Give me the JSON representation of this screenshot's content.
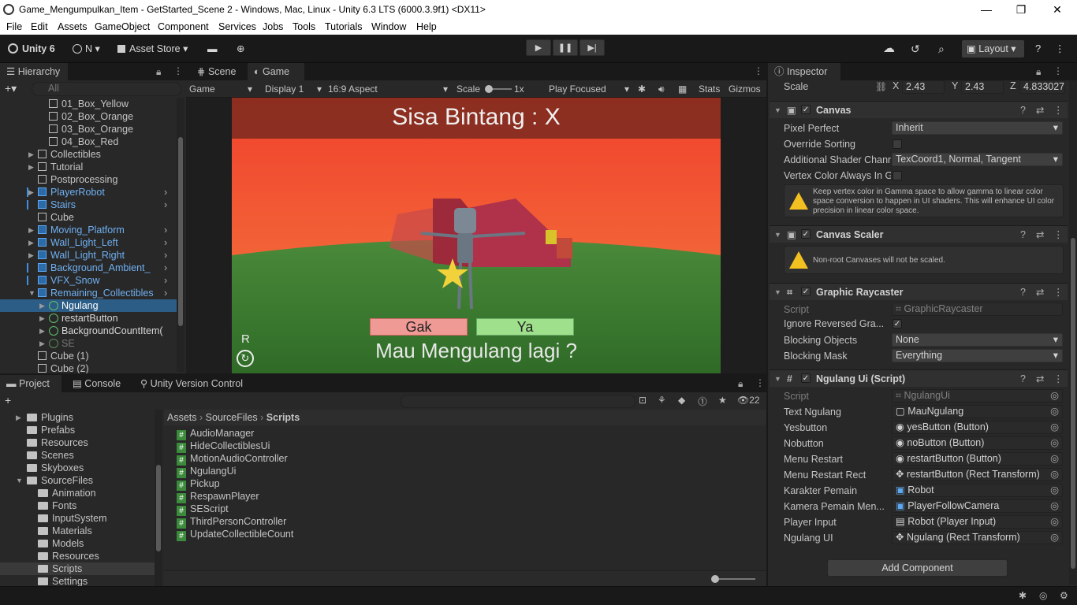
{
  "window": {
    "title": "Game_Mengumpulkan_Item - GetStarted_Scene 2 - Windows, Mac, Linux - Unity 6.3 LTS (6000.3.9f1) <DX11>",
    "minimize": "—",
    "maximize": "❐",
    "close": "✕"
  },
  "menu": [
    "File",
    "Edit",
    "Assets",
    "GameObject",
    "Component",
    "Services",
    "Jobs",
    "Tools",
    "Tutorials",
    "Window",
    "Help"
  ],
  "toolbar": {
    "unity": "Unity 6",
    "account": "N",
    "asset_store": "Asset Store",
    "layout": "Layout"
  },
  "hierarchy": {
    "tab": "Hierarchy",
    "search_placeholder": "All",
    "items": [
      {
        "label": "01_Box_Yellow"
      },
      {
        "label": "02_Box_Orange"
      },
      {
        "label": "03_Box_Orange"
      },
      {
        "label": "04_Box_Red"
      },
      {
        "label": "Collectibles"
      },
      {
        "label": "Tutorial"
      },
      {
        "label": "Postprocessing"
      },
      {
        "label": "PlayerRobot"
      },
      {
        "label": "Stairs"
      },
      {
        "label": "Cube"
      },
      {
        "label": "Moving_Platform"
      },
      {
        "label": "Wall_Light_Left"
      },
      {
        "label": "Wall_Light_Right"
      },
      {
        "label": "Background_Ambient_"
      },
      {
        "label": "VFX_Snow"
      },
      {
        "label": "Remaining_Collectibles"
      },
      {
        "label": "Ngulang"
      },
      {
        "label": "restartButton"
      },
      {
        "label": "BackgroundCountItem("
      },
      {
        "label": "SE"
      },
      {
        "label": "Cube (1)"
      },
      {
        "label": "Cube (2)"
      }
    ]
  },
  "view": {
    "tab_scene": "Scene",
    "tab_game": "Game",
    "game_dropdown": "Game",
    "display": "Display 1",
    "aspect": "16:9 Aspect",
    "scale_label": "Scale",
    "scale_value": "1x",
    "play_focused": "Play Focused",
    "stats": "Stats",
    "gizmos": "Gizmos"
  },
  "game": {
    "header_text": "Sisa Bintang : X",
    "btn_no": "Gak",
    "btn_yes": "Ya",
    "question": "Mau Mengulang lagi ?",
    "key_hint": "R"
  },
  "bottom": {
    "tab_project": "Project",
    "tab_console": "Console",
    "tab_vcs": "Unity Version Control",
    "hidden_count": "22",
    "breadcrumb": [
      "Assets",
      "SourceFiles",
      "Scripts"
    ],
    "folders": [
      {
        "label": "Plugins"
      },
      {
        "label": "Prefabs"
      },
      {
        "label": "Resources"
      },
      {
        "label": "Scenes"
      },
      {
        "label": "Skyboxes"
      },
      {
        "label": "SourceFiles"
      },
      {
        "label": "Animation"
      },
      {
        "label": "Fonts"
      },
      {
        "label": "InputSystem"
      },
      {
        "label": "Materials"
      },
      {
        "label": "Models"
      },
      {
        "label": "Resources"
      },
      {
        "label": "Scripts"
      },
      {
        "label": "Settings"
      }
    ],
    "scripts": [
      {
        "label": "AudioManager"
      },
      {
        "label": "HideCollectiblesUi"
      },
      {
        "label": "MotionAudioController"
      },
      {
        "label": "NgulangUi"
      },
      {
        "label": "Pickup"
      },
      {
        "label": "RespawnPlayer"
      },
      {
        "label": "SEScript"
      },
      {
        "label": "ThirdPersonController"
      },
      {
        "label": "UpdateCollectibleCount"
      }
    ]
  },
  "inspector": {
    "tab": "Inspector",
    "scale_label": "Scale",
    "scale_x": "2.43",
    "scale_y": "2.43",
    "scale_z": "4.833027",
    "canvas": {
      "title": "Canvas",
      "pixel_perfect_label": "Pixel Perfect",
      "pixel_perfect_value": "Inherit",
      "override_sorting": "Override Sorting",
      "shader_label": "Additional Shader Chann",
      "shader_value": "TexCoord1, Normal, Tangent",
      "vertex_color": "Vertex Color Always In G",
      "help": "Keep vertex color in Gamma space to allow gamma to linear color space conversion to happen in UI shaders. This will enhance UI color precision in linear color space."
    },
    "scaler": {
      "title": "Canvas Scaler",
      "help": "Non-root Canvases will not be scaled."
    },
    "raycaster": {
      "title": "Graphic Raycaster",
      "script_label": "Script",
      "script_value": "GraphicRaycaster",
      "ignore_label": "Ignore Reversed Gra...",
      "blocking_objects_label": "Blocking Objects",
      "blocking_objects_value": "None",
      "blocking_mask_label": "Blocking Mask",
      "blocking_mask_value": "Everything"
    },
    "ngulang": {
      "title": "Ngulang Ui (Script)",
      "fields": [
        {
          "label": "Script",
          "value": "NgulangUi"
        },
        {
          "label": "Text Ngulang",
          "value": "MauNgulang"
        },
        {
          "label": "Yesbutton",
          "value": "yesButton (Button)"
        },
        {
          "label": "Nobutton",
          "value": "noButton (Button)"
        },
        {
          "label": "Menu Restart",
          "value": "restartButton (Button)"
        },
        {
          "label": "Menu Restart Rect",
          "value": "restartButton (Rect Transform)"
        },
        {
          "label": "Karakter Pemain",
          "value": "Robot"
        },
        {
          "label": "Kamera Pemain Men...",
          "value": "PlayerFollowCamera"
        },
        {
          "label": "Player Input",
          "value": "Robot (Player Input)"
        },
        {
          "label": "Ngulang UI",
          "value": "Ngulang (Rect Transform)"
        }
      ]
    },
    "add_component": "Add Component"
  }
}
